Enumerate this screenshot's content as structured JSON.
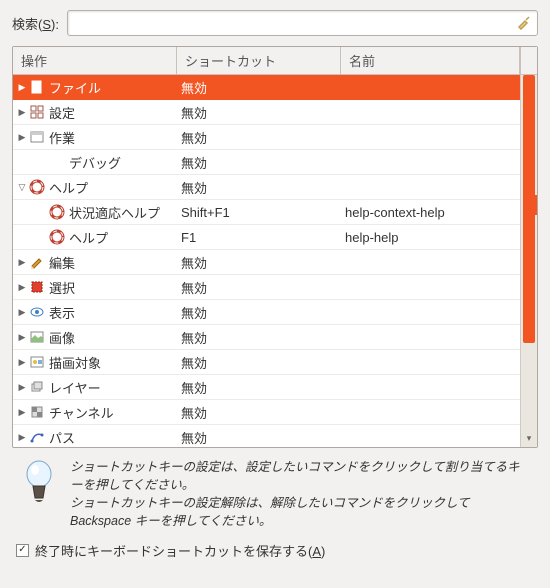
{
  "search": {
    "label_prefix": "検索(",
    "label_u": "S",
    "label_suffix": "):",
    "value": "",
    "placeholder": ""
  },
  "headers": {
    "op": "操作",
    "sc": "ショートカット",
    "nm": "名前"
  },
  "rows": [
    {
      "depth": 0,
      "exp": "▶",
      "icon": "file-icon",
      "label": "ファイル",
      "sc": "無効",
      "nm": "",
      "sel": true
    },
    {
      "depth": 0,
      "exp": "▶",
      "icon": "settings-icon",
      "label": "設定",
      "sc": "無効",
      "nm": ""
    },
    {
      "depth": 0,
      "exp": "▶",
      "icon": "work-icon",
      "label": "作業",
      "sc": "無効",
      "nm": ""
    },
    {
      "depth": 1,
      "exp": "",
      "icon": "",
      "label": "デバッグ",
      "sc": "無効",
      "nm": ""
    },
    {
      "depth": 0,
      "exp": "▽",
      "icon": "help-icon",
      "label": "ヘルプ",
      "sc": "無効",
      "nm": ""
    },
    {
      "depth": 1,
      "exp": "",
      "icon": "help-ctx-icon",
      "label": "状況適応ヘルプ",
      "sc": "Shift+F1",
      "nm": "help-context-help"
    },
    {
      "depth": 1,
      "exp": "",
      "icon": "help-ctx-icon",
      "label": "ヘルプ",
      "sc": "F1",
      "nm": "help-help"
    },
    {
      "depth": 0,
      "exp": "▶",
      "icon": "edit-icon",
      "label": "編集",
      "sc": "無効",
      "nm": ""
    },
    {
      "depth": 0,
      "exp": "▶",
      "icon": "select-icon",
      "label": "選択",
      "sc": "無効",
      "nm": ""
    },
    {
      "depth": 0,
      "exp": "▶",
      "icon": "view-icon",
      "label": "表示",
      "sc": "無効",
      "nm": ""
    },
    {
      "depth": 0,
      "exp": "▶",
      "icon": "image-icon",
      "label": "画像",
      "sc": "無効",
      "nm": ""
    },
    {
      "depth": 0,
      "exp": "▶",
      "icon": "drawable-icon",
      "label": "描画対象",
      "sc": "無効",
      "nm": ""
    },
    {
      "depth": 0,
      "exp": "▶",
      "icon": "layer-icon",
      "label": "レイヤー",
      "sc": "無効",
      "nm": ""
    },
    {
      "depth": 0,
      "exp": "▶",
      "icon": "channel-icon",
      "label": "チャンネル",
      "sc": "無効",
      "nm": ""
    },
    {
      "depth": 0,
      "exp": "▶",
      "icon": "path-icon",
      "label": "パス",
      "sc": "無効",
      "nm": ""
    }
  ],
  "hint": {
    "l1": "ショートカットキーの設定は、設定したいコマンドをクリックして割り当てるキーを押してください。",
    "l2": "ショートカットキーの設定解除は、解除したいコマンドをクリックして Backspace キーを押してください。"
  },
  "check": {
    "checked": "✓",
    "label_prefix": "終了時にキーボードショートカットを保存する(",
    "label_u": "A",
    "label_suffix": ")"
  }
}
